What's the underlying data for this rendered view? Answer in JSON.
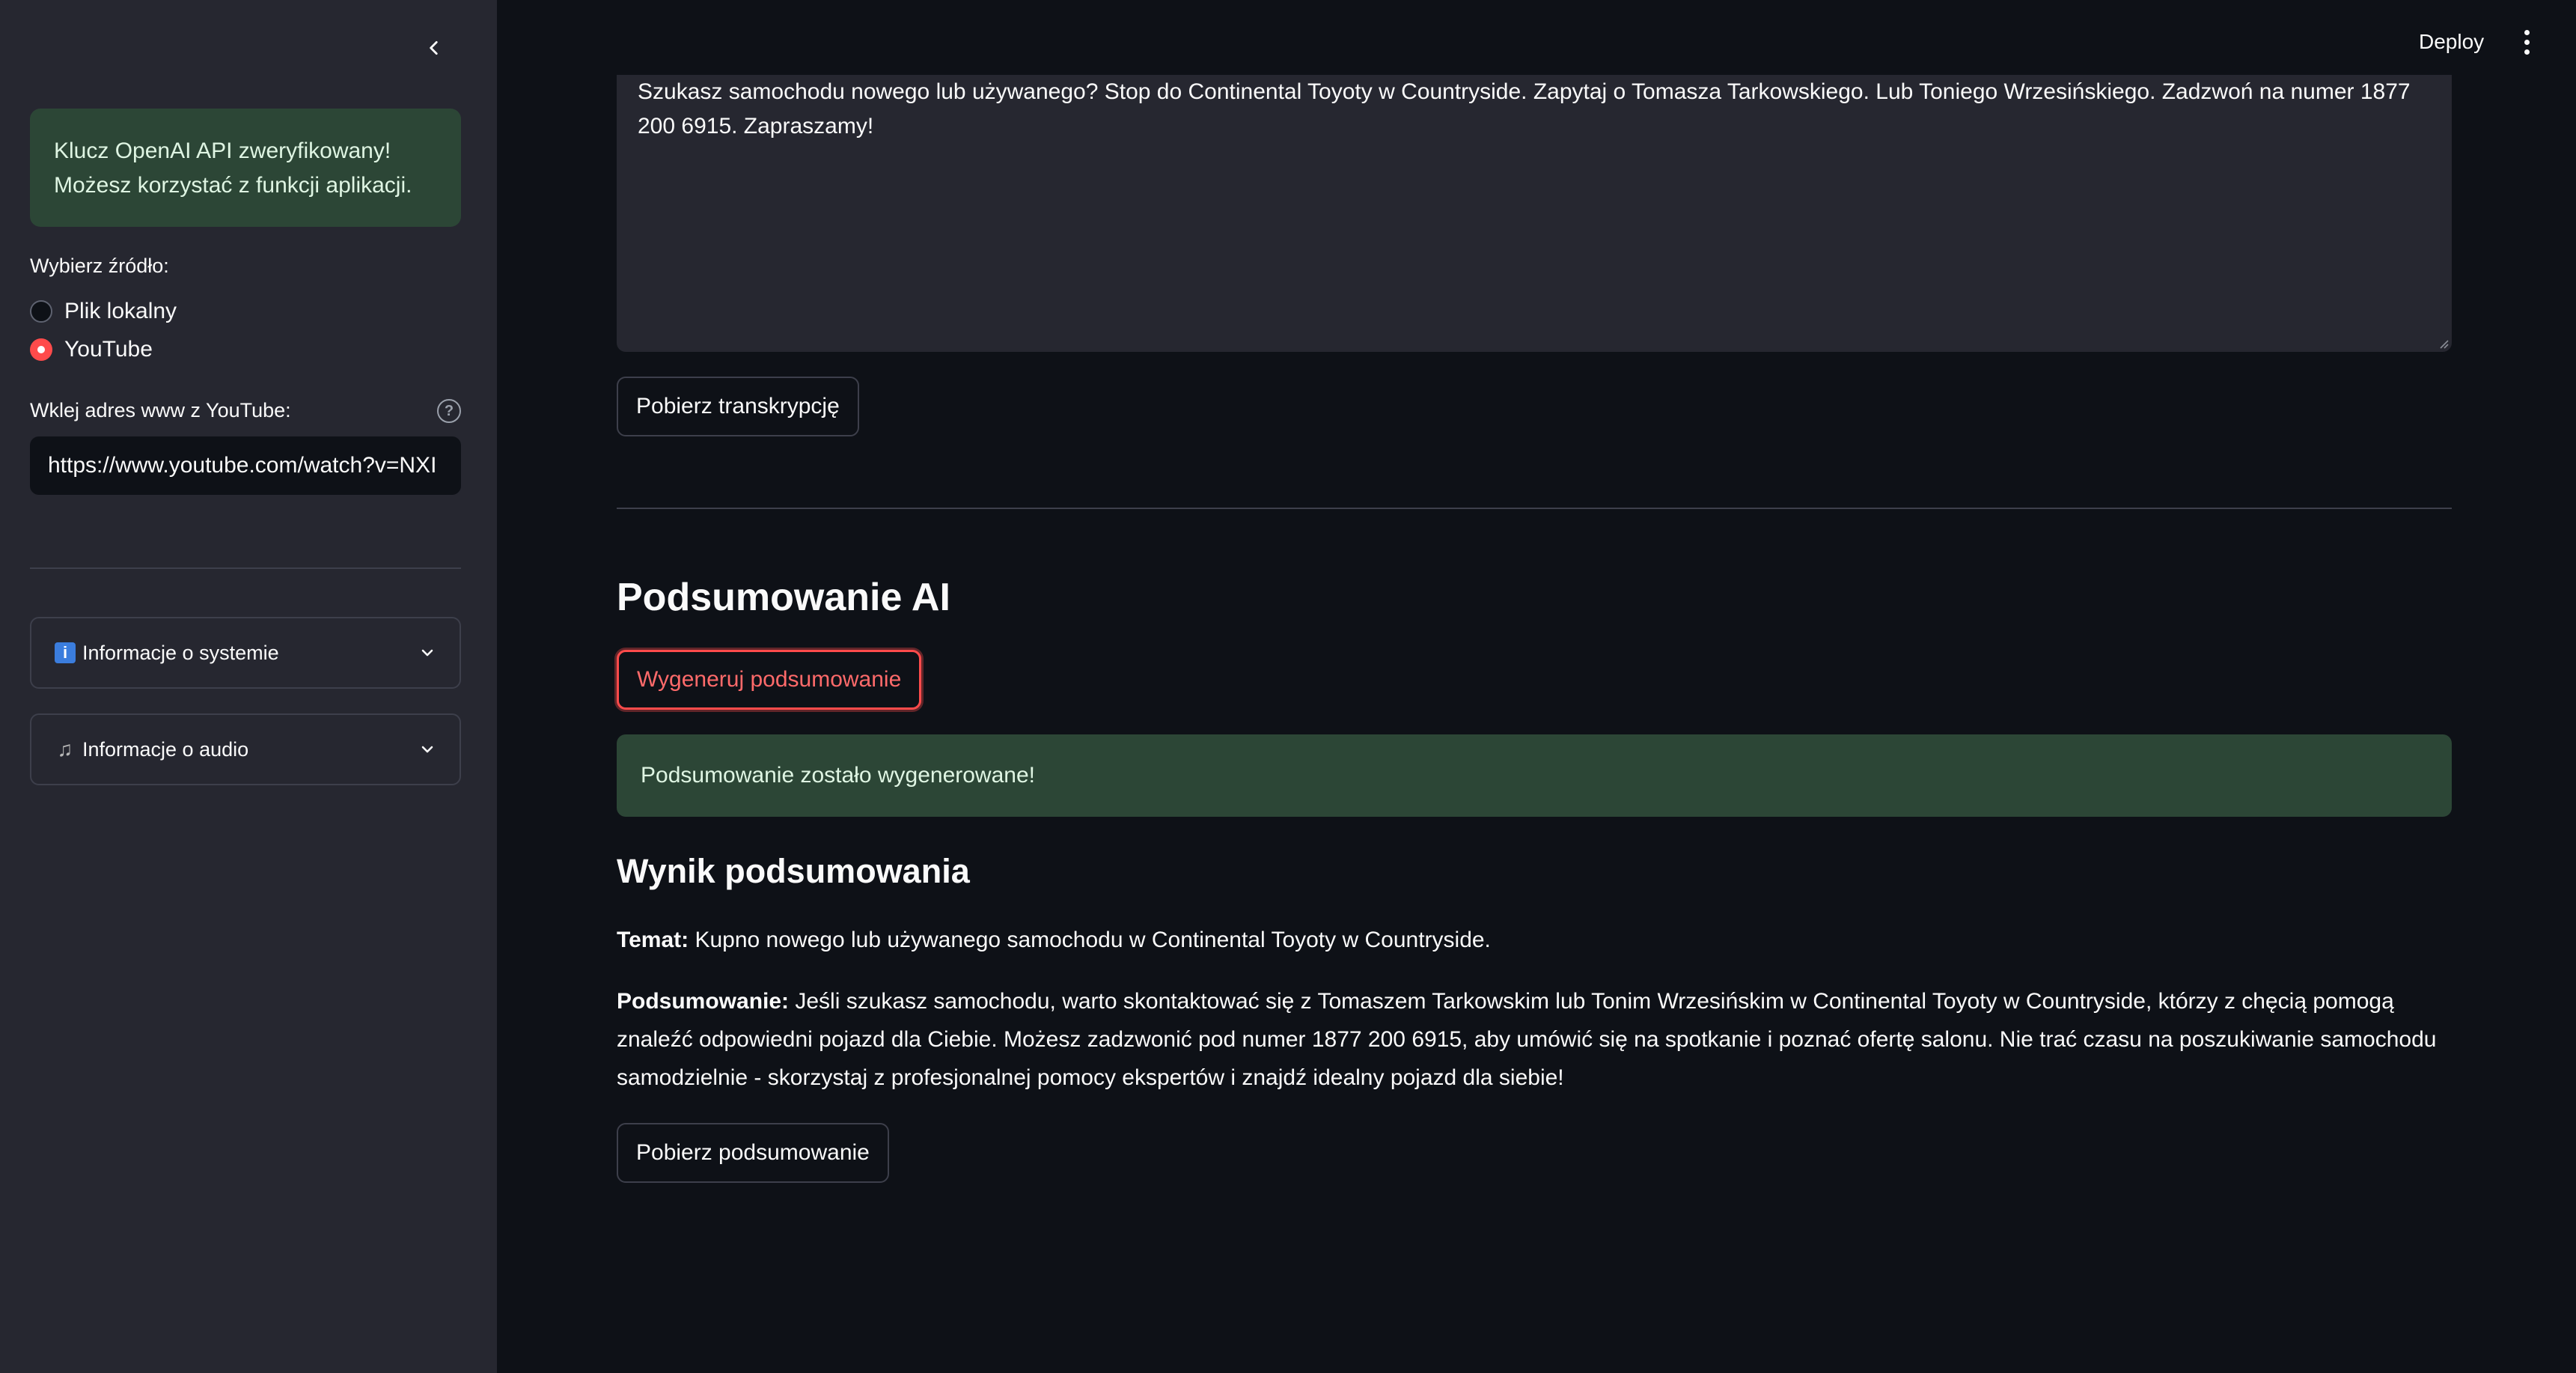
{
  "sidebar": {
    "alert": {
      "line1": "Klucz OpenAI API zweryfikowany!",
      "line2": "Możesz korzystać z funkcji aplikacji."
    },
    "source_label": "Wybierz źródło:",
    "source_options": [
      {
        "label": "Plik lokalny",
        "selected": false
      },
      {
        "label": "YouTube",
        "selected": true
      }
    ],
    "url_label": "Wklej adres www z YouTube:",
    "url_value": "https://www.youtube.com/watch?v=NXI",
    "expanders": [
      {
        "icon": "information-icon",
        "label": "Informacje o systemie"
      },
      {
        "icon": "music-note-icon",
        "label": "Informacje o audio"
      }
    ]
  },
  "header": {
    "deploy_label": "Deploy"
  },
  "main": {
    "transcript_text": "Szukasz samochodu nowego lub używanego? Stop do Continental Toyoty w Countryside. Zapytaj o Tomasza Tarkowskiego. Lub Toniego Wrzesińskiego. Zadzwoń na numer 1877 200 6915. Zapraszamy!",
    "download_transcript_label": "Pobierz transkrypcję",
    "ai_summary_heading": "Podsumowanie AI",
    "generate_summary_label": "Wygeneruj podsumowanie",
    "success_message": "Podsumowanie zostało wygenerowane!",
    "result_heading": "Wynik podsumowania",
    "topic_label": "Temat:",
    "topic_text": " Kupno nowego lub używanego samochodu w Continental Toyoty w Countryside.",
    "summary_label": "Podsumowanie:",
    "summary_text": " Jeśli szukasz samochodu, warto skontaktować się z Tomaszem Tarkowskim lub Tonim Wrzesińskim w Continental Toyoty w Countryside, którzy z chęcią pomogą znaleźć odpowiedni pojazd dla Ciebie. Możesz zadzwonić pod numer 1877 200 6915, aby umówić się na spotkanie i poznać ofertę salonu. Nie trać czasu na poszukiwanie samochodu samodzielnie - skorzystaj z profesjonalnej pomocy ekspertów i znajdź idealny pojazd dla siebie!",
    "download_summary_label": "Pobierz podsumowanie"
  },
  "colors": {
    "background": "#0e1117",
    "sidebar": "#262730",
    "success_bg": "#2c4636",
    "accent": "#ff4b4b"
  }
}
